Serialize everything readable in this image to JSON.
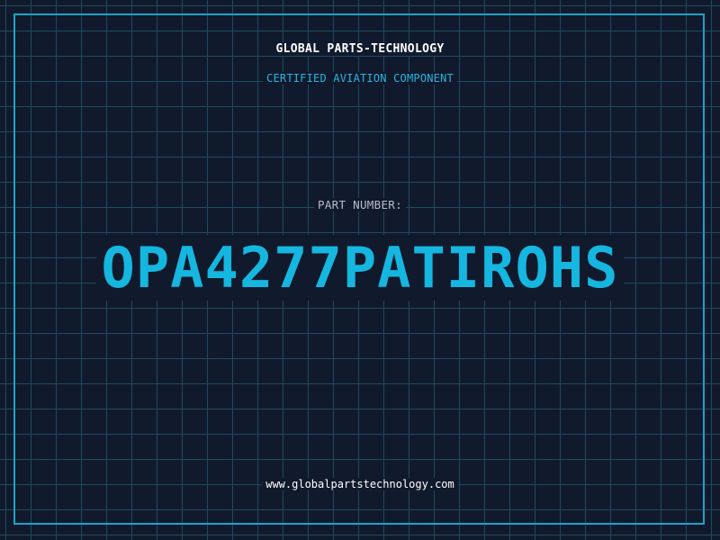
{
  "header": {
    "brand": "GLOBAL PARTS-TECHNOLOGY",
    "tagline": "CERTIFIED AVIATION COMPONENT"
  },
  "part": {
    "label": "PART NUMBER:",
    "number": "OPA4277PATIROHS"
  },
  "footer": {
    "website": "www.globalpartstechnology.com"
  },
  "colors": {
    "background": "#111a2d",
    "grid": "#1e4a60",
    "accent": "#15b6df",
    "frame": "#1aa3c9"
  }
}
